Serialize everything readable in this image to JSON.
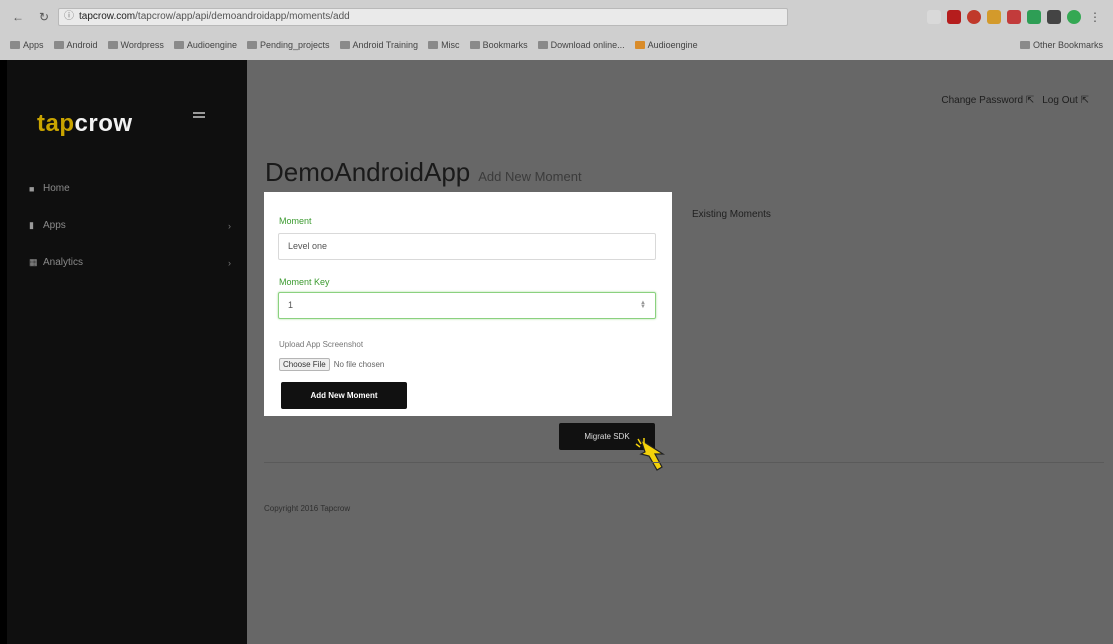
{
  "browser": {
    "url_host": "tapcrow.com",
    "url_path": "/tapcrow/app/api/demoandroidapp/moments/add",
    "bookmarks": [
      "Apps",
      "Android",
      "Wordpress",
      "Audioengine",
      "Pending_projects",
      "Android Training",
      "Misc",
      "Bookmarks",
      "Download online...",
      "Audioengine"
    ],
    "other_bookmarks": "Other Bookmarks"
  },
  "sidebar": {
    "logo_part1": "tap",
    "logo_part2": "crow",
    "items": [
      {
        "icon": "home-icon",
        "label": "Home"
      },
      {
        "icon": "apps-icon",
        "label": "Apps"
      },
      {
        "icon": "analytics-icon",
        "label": "Analytics"
      }
    ]
  },
  "header": {
    "change_password": "Change Password",
    "logout": "Log Out"
  },
  "page": {
    "app_name": "DemoAndroidApp",
    "subtitle": "Add New Moment",
    "existing_label": "Existing Moments"
  },
  "form": {
    "moment_label": "Moment",
    "moment_value": "Level one",
    "moment_key_label": "Moment Key",
    "moment_key_value": "1",
    "upload_label": "Upload App Screenshot",
    "choose_file": "Choose File",
    "no_file": "No file chosen",
    "add_button": "Add New Moment"
  },
  "migrate_button": "Migrate SDK",
  "footer": {
    "copyright": "Copyright 2016 Tapcrow"
  },
  "colors": {
    "brand": "#c9a400",
    "sidebar_bg": "#0f0f0f",
    "main_bg": "#676767",
    "label_green": "#3b9a2f"
  }
}
